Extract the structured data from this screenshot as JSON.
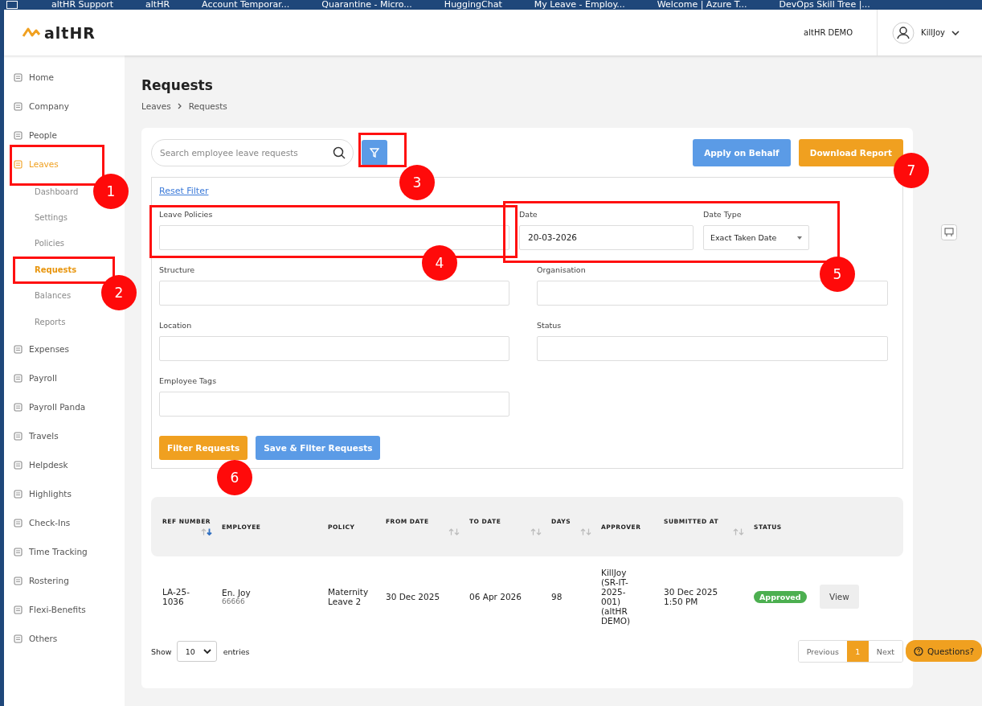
{
  "bookmarks": [
    {
      "label": "altHR Support"
    },
    {
      "label": "altHR"
    },
    {
      "label": "Account Temporar..."
    },
    {
      "label": "Quarantine - Micro..."
    },
    {
      "label": "HuggingChat"
    },
    {
      "label": "My Leave - Employ..."
    },
    {
      "label": "Welcome | Azure T..."
    },
    {
      "label": "DevOps Skill Tree |..."
    }
  ],
  "header": {
    "logo": "altHR",
    "company": "altHR DEMO",
    "user": "KillJoy"
  },
  "sidebar": {
    "items": [
      {
        "label": "Home",
        "selected": false
      },
      {
        "label": "Company",
        "selected": false
      },
      {
        "label": "People",
        "selected": false
      },
      {
        "label": "Leaves",
        "selected": true,
        "children": [
          {
            "label": "Dashboard",
            "selected": false
          },
          {
            "label": "Settings",
            "selected": false
          },
          {
            "label": "Policies",
            "selected": false
          },
          {
            "label": "Requests",
            "selected": true
          },
          {
            "label": "Balances",
            "selected": false
          },
          {
            "label": "Reports",
            "selected": false
          }
        ]
      },
      {
        "label": "Expenses",
        "selected": false
      },
      {
        "label": "Payroll",
        "selected": false
      },
      {
        "label": "Payroll Panda",
        "selected": false
      },
      {
        "label": "Travels",
        "selected": false
      },
      {
        "label": "Helpdesk",
        "selected": false
      },
      {
        "label": "Highlights",
        "selected": false
      },
      {
        "label": "Check-Ins",
        "selected": false
      },
      {
        "label": "Time Tracking",
        "selected": false
      },
      {
        "label": "Rostering",
        "selected": false
      },
      {
        "label": "Flexi-Benefits",
        "selected": false
      },
      {
        "label": "Others",
        "selected": false
      }
    ]
  },
  "page": {
    "title": "Requests",
    "breadcrumb": [
      "Leaves",
      "Requests"
    ]
  },
  "toolbar": {
    "search_placeholder": "Search employee leave requests",
    "buttons": [
      {
        "label": "Apply on Behalf",
        "kind": "primary"
      },
      {
        "label": "Download Report",
        "kind": "accent"
      }
    ]
  },
  "filters": {
    "reset": "Reset Filter",
    "fields": [
      {
        "label": "Leave Policies",
        "kind": "text"
      },
      {
        "label": "Date",
        "value": "20-03-2026",
        "kind": "text"
      },
      {
        "label": "Date Type",
        "value": "Exact Taken Date",
        "kind": "select"
      },
      {
        "label": "Structure",
        "kind": "text"
      },
      {
        "label": "Organisation",
        "kind": "text"
      },
      {
        "label": "Location",
        "kind": "text"
      },
      {
        "label": "Status",
        "kind": "text"
      },
      {
        "label": "Employee Tags",
        "kind": "text"
      }
    ],
    "buttons": [
      {
        "label": "Filter Requests",
        "kind": "accent"
      },
      {
        "label": "Save & Filter Requests",
        "kind": "primary"
      }
    ]
  },
  "table": {
    "columns": [
      {
        "label": "REF NUMBER",
        "sorted": true
      },
      {
        "label": "EMPLOYEE"
      },
      {
        "label": "POLICY"
      },
      {
        "label": "FROM DATE",
        "sorted": false
      },
      {
        "label": "TO DATE",
        "sorted": false
      },
      {
        "label": "DAYS",
        "sorted": false
      },
      {
        "label": "APPROVER"
      },
      {
        "label": "SUBMITTED AT",
        "sorted": false
      },
      {
        "label": "STATUS"
      }
    ],
    "rows": [
      {
        "ref": "LA-25-1036",
        "employee": "En. Joy",
        "employee_id": "66666",
        "policy": "Maternity Leave 2",
        "from": "30 Dec 2025",
        "to": "06 Apr 2026",
        "days": "98",
        "approver": "KillJoy (SR-IT-2025-001) (altHR DEMO)",
        "submitted": "30 Dec 2025 1:50 PM",
        "status": "Approved",
        "action": "View"
      }
    ]
  },
  "pagination": {
    "show": "Show",
    "page_size": "10",
    "entries": "entries",
    "previous": "Previous",
    "pages": [
      {
        "label": "1",
        "selected": true
      }
    ],
    "next": "Next"
  },
  "help_button": "Questions?",
  "annotations": [
    {
      "number": "1"
    },
    {
      "number": "2"
    },
    {
      "number": "3"
    },
    {
      "number": "4"
    },
    {
      "number": "5"
    },
    {
      "number": "6"
    },
    {
      "number": "7"
    }
  ]
}
